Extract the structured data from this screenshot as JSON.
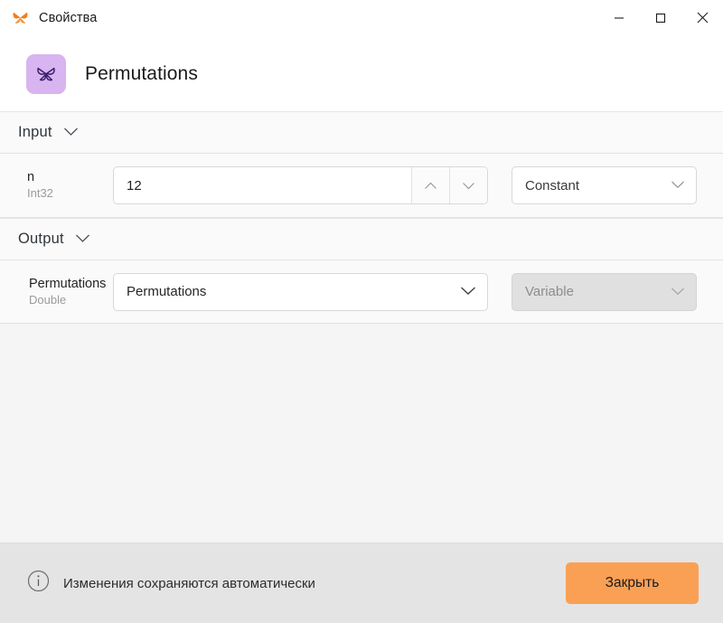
{
  "window": {
    "title": "Свойства",
    "icon": "butterfly-icon",
    "controls": {
      "minimize": "minimize-icon",
      "maximize": "maximize-icon",
      "close": "close-icon"
    }
  },
  "header": {
    "icon": "butterfly-icon",
    "icon_bg": "#d8b4f0",
    "title": "Permutations"
  },
  "sections": [
    {
      "id": "input",
      "label": "Input",
      "chevron": "chevron-down-icon",
      "rows": [
        {
          "name": "n",
          "type": "Int32",
          "value": "12",
          "stepper_up": "chevron-up-icon",
          "stepper_down": "chevron-down-icon",
          "mode": "Constant",
          "mode_disabled": false
        }
      ]
    },
    {
      "id": "output",
      "label": "Output",
      "chevron": "chevron-down-icon",
      "rows": [
        {
          "name": "Permutations",
          "type": "Double",
          "value": "Permutations",
          "mode": "Variable",
          "mode_disabled": true
        }
      ]
    }
  ],
  "footer": {
    "info_icon": "info-circle-icon",
    "note": "Изменения сохраняются автоматически",
    "close_button": "Закрыть",
    "accent_color": "#f9a055"
  }
}
